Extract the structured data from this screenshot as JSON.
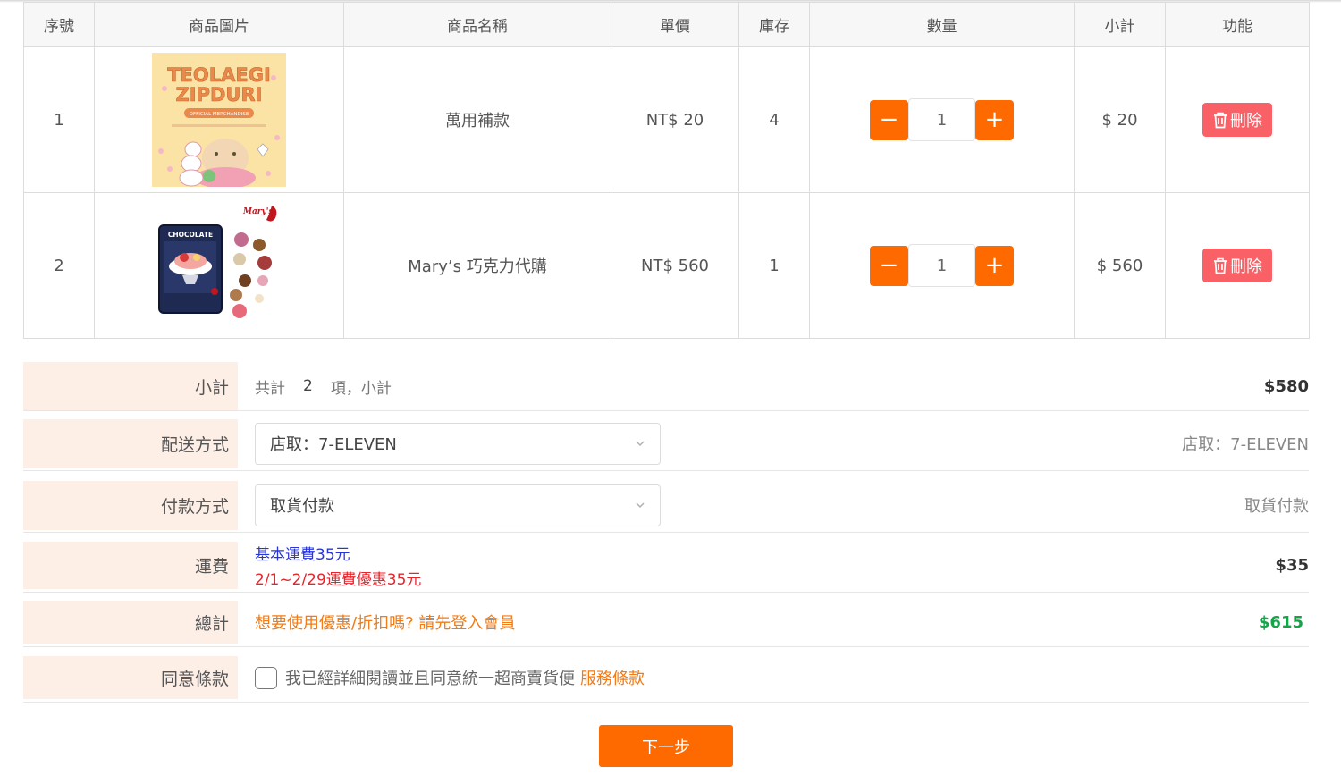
{
  "table": {
    "headers": [
      "序號",
      "商品圖片",
      "商品名稱",
      "單價",
      "庫存",
      "數量",
      "小計",
      "功能"
    ],
    "rows": [
      {
        "index": "1",
        "name": "萬用補款",
        "price": "NT$ 20",
        "stock": "4",
        "qty": "1",
        "subtotal": "$ 20",
        "image_icon": "product-poster-image",
        "image_text": {
          "line1": "TEOLAEGI",
          "line2": "ZIPDURI",
          "tag": "OFFICIAL MERCHANDISE"
        }
      },
      {
        "index": "2",
        "name": "Mary’s 巧克力代購",
        "price": "NT$ 560",
        "stock": "1",
        "qty": "1",
        "subtotal": "$ 560",
        "image_icon": "chocolate-box-image",
        "image_text": {
          "brand": "Mary's",
          "box": "CHOCOLATE"
        }
      }
    ],
    "minus_label": "−",
    "plus_label": "+",
    "delete_label": "刪除"
  },
  "summary": {
    "subtotal_label": "小計",
    "count_prefix": "共計",
    "count": "2",
    "count_suffix": "項，小計",
    "subtotal_value": "$580",
    "shipping_label": "配送方式",
    "shipping_selected": "店取：7-ELEVEN",
    "shipping_display": "店取：7-ELEVEN",
    "payment_label": "付款方式",
    "payment_selected": "取貨付款",
    "payment_display": "取貨付款",
    "fee_label": "運費",
    "fee_line1": "基本運費35元",
    "fee_line2": "2/1~2/29運費優惠35元",
    "fee_value": "$35",
    "total_label": "總計",
    "total_note": "想要使用優惠/折扣嗎? 請先登入會員",
    "total_value": "$615",
    "terms_label": "同意條款",
    "terms_text": "我已經詳細閱讀並且同意統一超商賣貨便",
    "terms_link": "服務條款",
    "next_label": "下一步"
  },
  "colors": {
    "accent": "#ff6a00",
    "delete": "#f96167",
    "label_bg": "#fdeee6",
    "fee_blue": "#2a35d8",
    "fee_red": "#e3252c",
    "note_orange": "#f07b17",
    "total_green": "#17a34a"
  }
}
